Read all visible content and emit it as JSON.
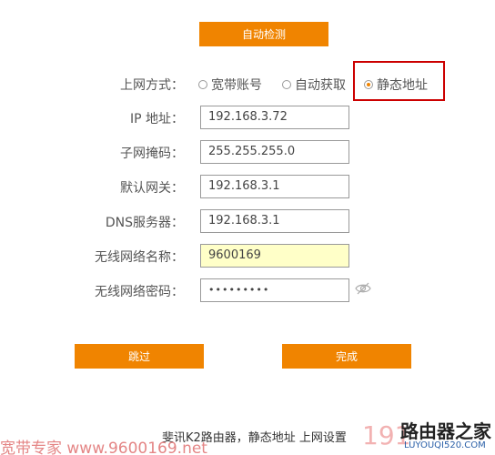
{
  "top_button": {
    "label": "自动检测"
  },
  "connection": {
    "label": "上网方式：",
    "options": [
      {
        "label": "宽带账号",
        "selected": false
      },
      {
        "label": "自动获取",
        "selected": false
      },
      {
        "label": "静态地址",
        "selected": true
      }
    ]
  },
  "fields": {
    "ip": {
      "label": "IP 地址：",
      "value": "192.168.3.72"
    },
    "mask": {
      "label": "子网掩码：",
      "value": "255.255.255.0"
    },
    "gateway": {
      "label": "默认网关：",
      "value": "192.168.3.1"
    },
    "dns": {
      "label": "DNS服务器：",
      "value": "192.168.3.1"
    },
    "ssid": {
      "label": "无线网络名称：",
      "value": "9600169"
    },
    "password": {
      "label": "无线网络密码：",
      "value": "•••••••••"
    }
  },
  "buttons": {
    "skip": "跳过",
    "done": "完成"
  },
  "caption": "斐讯K2路由器，静态地址 上网设置",
  "watermarks": {
    "left": "宽带专家 www.9600169.net",
    "right_number": "191",
    "logo_cn": "路由器之家",
    "logo_en": "LUYOUQI520.COM"
  },
  "colors": {
    "accent": "#f08400",
    "highlight_box": "#cc0000",
    "ssid_bg": "#ffffc8"
  }
}
